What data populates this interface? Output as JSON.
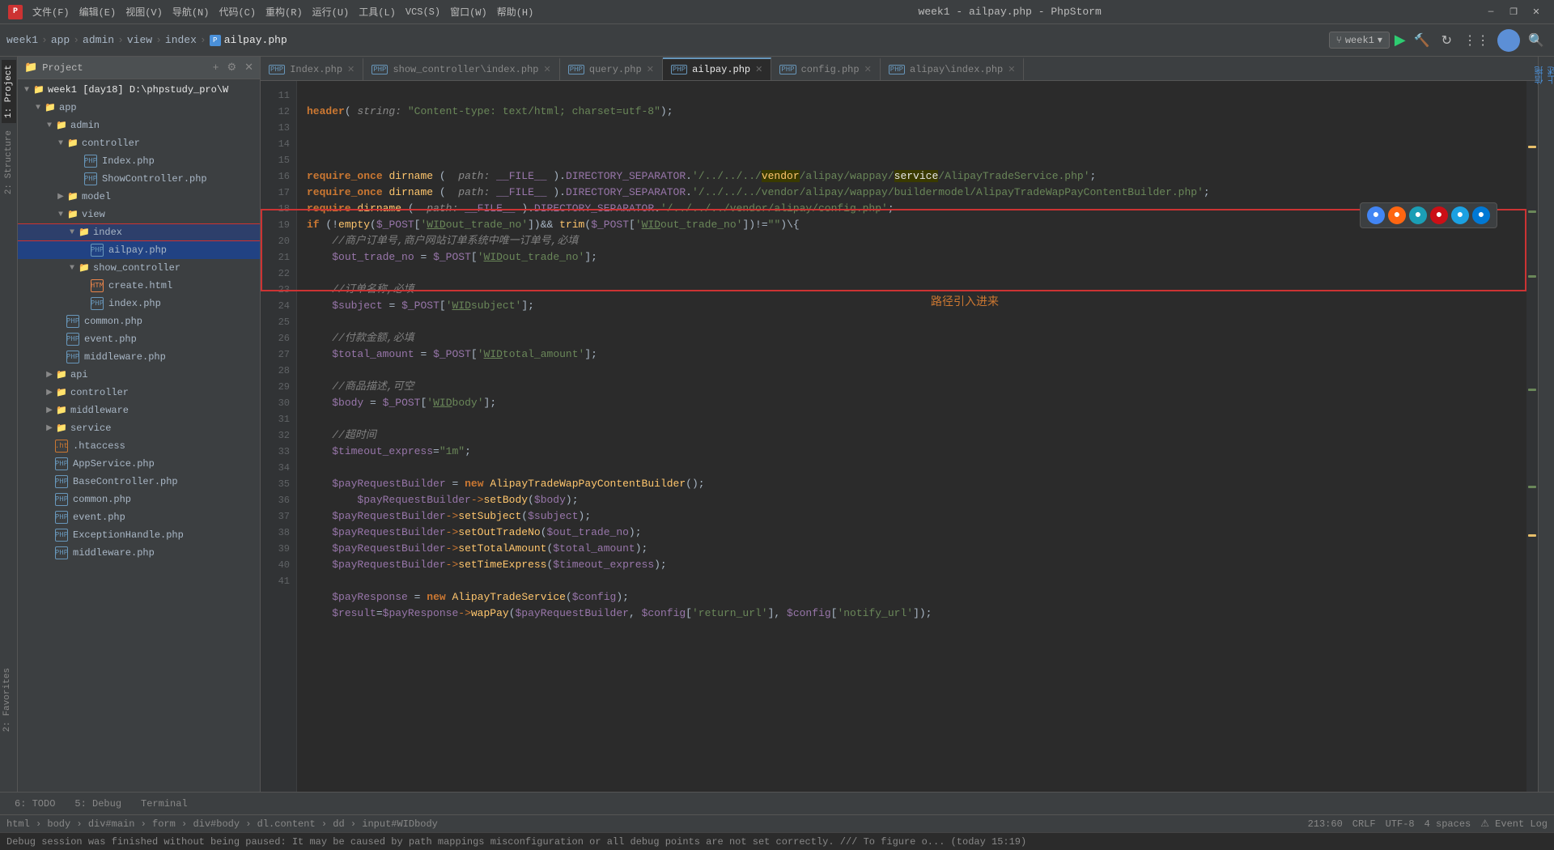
{
  "titlebar": {
    "title": "week1 - ailpay.php - PhpStorm",
    "logo": "P",
    "menus": [
      "文件(F)",
      "编辑(E)",
      "视图(V)",
      "导航(N)",
      "代码(C)",
      "重构(R)",
      "运行(U)",
      "工具(L)",
      "VCS(S)",
      "窗口(W)",
      "帮助(H)"
    ],
    "win_min": "—",
    "win_max": "❐",
    "win_close": "✕"
  },
  "toolbar": {
    "breadcrumbs": [
      "week1",
      "app",
      "admin",
      "view",
      "index",
      "ailpay.php"
    ],
    "branch": "week1",
    "run_icon": "▶",
    "build_icon": "🔨",
    "reload_icon": "↻"
  },
  "sidebar": {
    "panel_title": "Project",
    "project_label": "week1 [day18] D:\\phpstudy_pro\\W",
    "items": [
      {
        "label": "app",
        "type": "folder",
        "indent": 1,
        "expanded": true
      },
      {
        "label": "admin",
        "type": "folder",
        "indent": 2,
        "expanded": true
      },
      {
        "label": "controller",
        "type": "folder",
        "indent": 3,
        "expanded": true
      },
      {
        "label": "Index.php",
        "type": "php",
        "indent": 4
      },
      {
        "label": "ShowController.php",
        "type": "php",
        "indent": 4
      },
      {
        "label": "model",
        "type": "folder",
        "indent": 3,
        "expanded": false
      },
      {
        "label": "view",
        "type": "folder",
        "indent": 3,
        "expanded": true
      },
      {
        "label": "index",
        "type": "folder",
        "indent": 4,
        "expanded": true,
        "selected_folder": true
      },
      {
        "label": "ailpay.php",
        "type": "php",
        "indent": 5,
        "selected": true
      },
      {
        "label": "show_controller",
        "type": "folder",
        "indent": 4,
        "expanded": true
      },
      {
        "label": "create.html",
        "type": "html",
        "indent": 5
      },
      {
        "label": "index.php",
        "type": "php",
        "indent": 5
      },
      {
        "label": "common.php",
        "type": "php",
        "indent": 3
      },
      {
        "label": "event.php",
        "type": "php",
        "indent": 3
      },
      {
        "label": "middleware.php",
        "type": "php",
        "indent": 3
      },
      {
        "label": "api",
        "type": "folder",
        "indent": 2,
        "expanded": false
      },
      {
        "label": "controller",
        "type": "folder",
        "indent": 2,
        "expanded": false
      },
      {
        "label": "middleware",
        "type": "folder",
        "indent": 2,
        "expanded": false
      },
      {
        "label": "service",
        "type": "folder",
        "indent": 2,
        "expanded": false
      },
      {
        "label": ".htaccess",
        "type": "file",
        "indent": 2
      },
      {
        "label": "AppService.php",
        "type": "php",
        "indent": 2
      },
      {
        "label": "BaseController.php",
        "type": "php",
        "indent": 2
      },
      {
        "label": "common.php",
        "type": "php",
        "indent": 2
      },
      {
        "label": "event.php",
        "type": "php",
        "indent": 2
      },
      {
        "label": "ExceptionHandle.php",
        "type": "php",
        "indent": 2
      },
      {
        "label": "middleware.php",
        "type": "php",
        "indent": 2
      }
    ]
  },
  "tabs": [
    {
      "label": "Index.php",
      "type": "php",
      "active": false
    },
    {
      "label": "show_controller\\index.php",
      "type": "php",
      "active": false
    },
    {
      "label": "query.php",
      "type": "php",
      "active": false
    },
    {
      "label": "ailpay.php",
      "type": "php",
      "active": true
    },
    {
      "label": "config.php",
      "type": "php",
      "active": false
    },
    {
      "label": "alipay\\index.php",
      "type": "php",
      "active": false
    }
  ],
  "code": {
    "lines": [
      {
        "num": 11,
        "content": "header( string: \"Content-type: text/html; charset=utf-8\");"
      },
      {
        "num": 12,
        "content": ""
      },
      {
        "num": 13,
        "content": ""
      },
      {
        "num": 14,
        "content": "require_once dirname (  path: __FILE__ ).DIRECTORY_SEPARATOR.'/../../../vendor/alipay/wappay/service/AlipayTradeService.php';"
      },
      {
        "num": 15,
        "content": "require_once dirname (  path: __FILE__ ).DIRECTORY_SEPARATOR.'/../../../vendor/alipay/wappay/buildermodel/AlipayTradeWapPayContentBuilder.php';"
      },
      {
        "num": 16,
        "content": "require dirname (  path: __FILE__ ).DIRECTORY_SEPARATOR.'/../../../vendor/alipay/config.php';"
      },
      {
        "num": 17,
        "content": "if (!empty($_POST['WIDout_trade_no'])&& trim($_POST['WIDout_trade_no'])!=\"\"){"
      },
      {
        "num": 18,
        "content": "    //商户订单号,商户网站订单系统中唯一订单号,必填"
      },
      {
        "num": 19,
        "content": "    $out_trade_no = $_POST['WIDout_trade_no'];"
      },
      {
        "num": 20,
        "content": ""
      },
      {
        "num": 21,
        "content": "    //订单名称,必填"
      },
      {
        "num": 22,
        "content": "    $subject = $_POST['WIDsubject'];"
      },
      {
        "num": 23,
        "content": ""
      },
      {
        "num": 24,
        "content": "    //付款金额,必填"
      },
      {
        "num": 25,
        "content": "    $total_amount = $_POST['WIDtotal_amount'];"
      },
      {
        "num": 26,
        "content": ""
      },
      {
        "num": 27,
        "content": "    //商品描述,可空"
      },
      {
        "num": 28,
        "content": "    $body = $_POST['WIDbody'];"
      },
      {
        "num": 29,
        "content": ""
      },
      {
        "num": 30,
        "content": "    //超时间"
      },
      {
        "num": 31,
        "content": "    $timeout_express=\"1m\";"
      },
      {
        "num": 32,
        "content": ""
      },
      {
        "num": 33,
        "content": "    $payRequestBuilder = new AlipayTradeWapPayContentBuilder();"
      },
      {
        "num": 34,
        "content": "        $payRequestBuilder->setBody($body);"
      },
      {
        "num": 35,
        "content": "    $payRequestBuilder->setSubject($subject);"
      },
      {
        "num": 36,
        "content": "    $payRequestBuilder->setOutTradeNo($out_trade_no);"
      },
      {
        "num": 37,
        "content": "    $payRequestBuilder->setTotalAmount($total_amount);"
      },
      {
        "num": 38,
        "content": "    $payRequestBuilder->setTimeExpress($timeout_express);"
      },
      {
        "num": 39,
        "content": ""
      },
      {
        "num": 40,
        "content": "    $payResponse = new AlipayTradeService($config);"
      },
      {
        "num": 41,
        "content": "    $result=$payResponse->wapPay($payRequestBuilder, $config['return_url'], $config['notify_url']);"
      }
    ],
    "annotation": "路径引入进来"
  },
  "statusbar": {
    "breadcrumb": "html › body › div#main › form › div#body › dl.content › dd › input#WIDbody",
    "line_col": "213:60",
    "line_ending": "CRLF",
    "encoding": "UTF-8",
    "indent": "4 spaces"
  },
  "msgbar": {
    "message": "Debug session was finished without being paused: It may be caused by path mappings misconfiguration or all debug points are not set correctly. /// To figure o... (today 15:19)"
  },
  "bottom_tabs": [
    {
      "label": "6: TODO",
      "active": false
    },
    {
      "label": "5: Debug",
      "active": false
    },
    {
      "label": "Terminal",
      "active": false
    }
  ],
  "browser_icons": [
    "Chrome",
    "Firefox",
    "Safari",
    "Opera",
    "IE",
    "Edge"
  ],
  "right_panel": {
    "label": "信拖上述"
  },
  "side_labels": {
    "project": "1: Project",
    "structure": "2: Structure",
    "favorites": "2: Favorites"
  }
}
